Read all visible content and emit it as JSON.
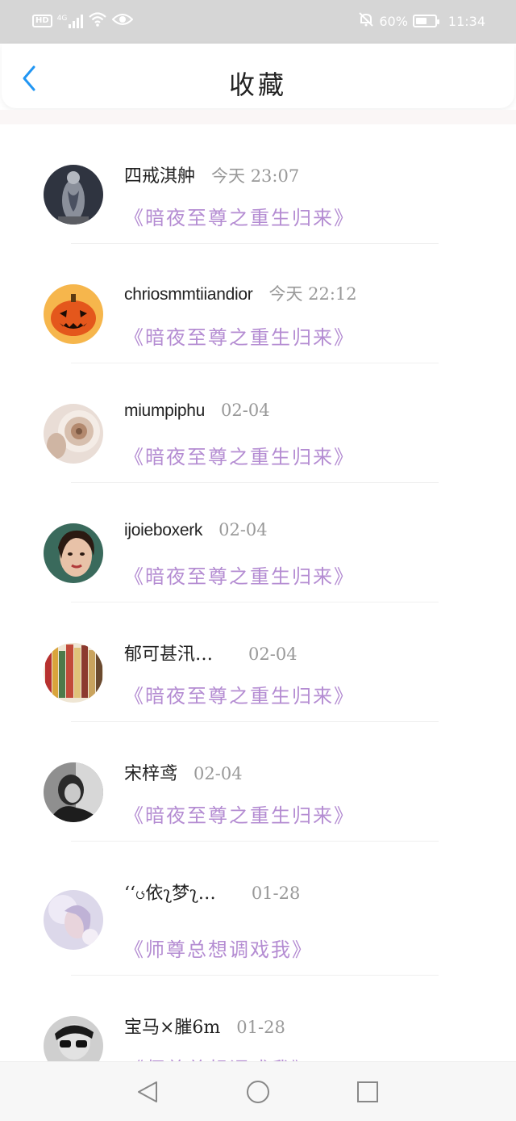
{
  "status_bar": {
    "hd_label": "HD",
    "network_label": "4G",
    "battery_percent": "60%",
    "battery_level": 0.6,
    "time": "11:34"
  },
  "header": {
    "title": "收藏",
    "back_icon": "chevron-left-icon",
    "accent_color": "#2196f3"
  },
  "favorites": [
    {
      "username": "四戒淇舯",
      "time": "今天  23:07",
      "book": "《暗夜至尊之重生归来》",
      "avatar_icon": "tattoo-back-photo"
    },
    {
      "username": "chriosmmtiiandior",
      "time": "今天  22:12",
      "book": "《暗夜至尊之重生归来》",
      "avatar_icon": "pumpkin-photo"
    },
    {
      "username": "miumpiphu",
      "time": "02-04",
      "book": "《暗夜至尊之重生归来》",
      "avatar_icon": "shell-photo"
    },
    {
      "username": "ijoieboxerk",
      "time": "02-04",
      "book": "《暗夜至尊之重生归来》",
      "avatar_icon": "portrait-photo"
    },
    {
      "username": "郁可甚汛…",
      "time": "02-04",
      "book": "《暗夜至尊之重生归来》",
      "avatar_icon": "books-photo"
    },
    {
      "username": "宋梓鸢",
      "time": "02-04",
      "book": "《暗夜至尊之重生归来》",
      "avatar_icon": "bw-portrait-photo"
    },
    {
      "username": "‘‘ၒ依ʅ梦ʅ…",
      "time": "01-28",
      "book": "《师尊总想调戏我》",
      "avatar_icon": "pastel-photo"
    },
    {
      "username": "宝马×膗6m",
      "time": "01-28",
      "book": "《师尊总想调戏我》",
      "avatar_icon": "sunglasses-photo"
    }
  ],
  "colors": {
    "book_title": "#b48cd2",
    "username": "#222222",
    "time": "#999999"
  },
  "nav": {
    "back_icon": "triangle-back-icon",
    "home_icon": "circle-home-icon",
    "recents_icon": "square-recents-icon"
  }
}
